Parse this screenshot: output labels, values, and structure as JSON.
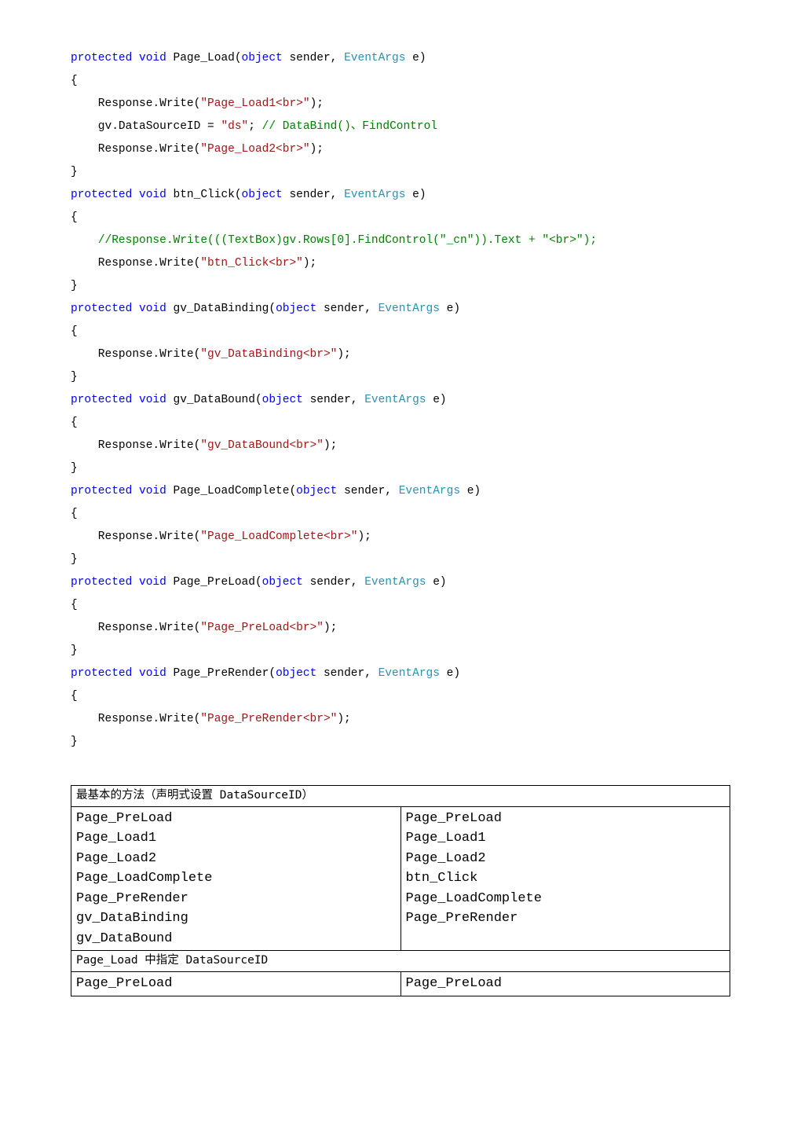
{
  "code": {
    "l01a": "protected void",
    "l01b": " Page_Load(",
    "l01c": "object",
    "l01d": " sender, ",
    "l01e": "EventArgs",
    "l01f": " e)",
    "l02": "{",
    "l03a": "    Response.Write(",
    "l03b": "\"Page_Load1<br>\"",
    "l03c": ");",
    "l04a": "    gv.DataSourceID = ",
    "l04b": "\"ds\"",
    "l04c": "; ",
    "l04d": "// DataBind()、FindControl",
    "l05a": "    Response.Write(",
    "l05b": "\"Page_Load2<br>\"",
    "l05c": ");",
    "l06": "}",
    "l07a": "protected void",
    "l07b": " btn_Click(",
    "l07c": "object",
    "l07d": " sender, ",
    "l07e": "EventArgs",
    "l07f": " e)",
    "l08": "{",
    "l09a": "    ",
    "l09b": "//Response.Write(((TextBox)gv.Rows[0].FindControl(\"_cn\")).Text + \"<br>\");",
    "l10a": "    Response.Write(",
    "l10b": "\"btn_Click<br>\"",
    "l10c": ");",
    "l11": "}",
    "l12a": "protected void",
    "l12b": " gv_DataBinding(",
    "l12c": "object",
    "l12d": " sender, ",
    "l12e": "EventArgs",
    "l12f": " e)",
    "l13": "{",
    "l14a": "    Response.Write(",
    "l14b": "\"gv_DataBinding<br>\"",
    "l14c": ");",
    "l15": "}",
    "l16a": "protected void",
    "l16b": " gv_DataBound(",
    "l16c": "object",
    "l16d": " sender, ",
    "l16e": "EventArgs",
    "l16f": " e)",
    "l17": "{",
    "l18a": "    Response.Write(",
    "l18b": "\"gv_DataBound<br>\"",
    "l18c": ");",
    "l19": "}",
    "l20a": "protected void",
    "l20b": " Page_LoadComplete(",
    "l20c": "object",
    "l20d": " sender, ",
    "l20e": "EventArgs",
    "l20f": " e)",
    "l21": "{",
    "l22a": "    Response.Write(",
    "l22b": "\"Page_LoadComplete<br>\"",
    "l22c": ");",
    "l23": "}",
    "l24a": "protected void",
    "l24b": " Page_PreLoad(",
    "l24c": "object",
    "l24d": " sender, ",
    "l24e": "EventArgs",
    "l24f": " e)",
    "l25": "{",
    "l26a": "    Response.Write(",
    "l26b": "\"Page_PreLoad<br>\"",
    "l26c": ");",
    "l27": "}",
    "l28a": "protected void",
    "l28b": " Page_PreRender(",
    "l28c": "object",
    "l28d": " sender, ",
    "l28e": "EventArgs",
    "l28f": " e)",
    "l29": "{",
    "l30a": "    Response.Write(",
    "l30b": "\"Page_PreRender<br>\"",
    "l30c": ");",
    "l31": "}"
  },
  "table": {
    "h1": "最基本的方法（声明式设置 DataSourceID）",
    "r1c1": "Page_PreLoad\nPage_Load1\nPage_Load2\nPage_LoadComplete\nPage_PreRender\ngv_DataBinding\ngv_DataBound",
    "r1c2": "Page_PreLoad\nPage_Load1\nPage_Load2\nbtn_Click\nPage_LoadComplete\nPage_PreRender",
    "h2": "Page_Load 中指定 DataSourceID",
    "r2c1": "Page_PreLoad",
    "r2c2": "Page_PreLoad"
  }
}
